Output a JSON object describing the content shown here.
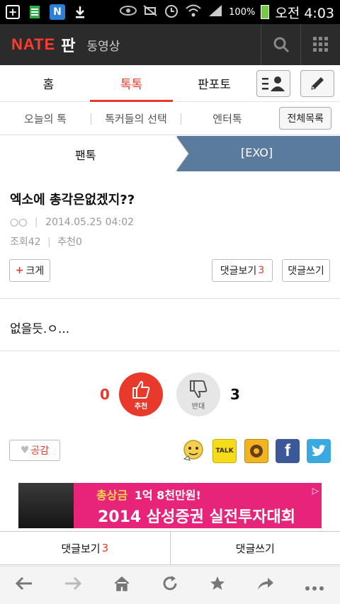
{
  "statusbar": {
    "icons": [
      "plus-box-icon",
      "sim-card-icon",
      "n-app-icon",
      "download-icon",
      "eye-icon",
      "mute-icon",
      "alarm-icon",
      "wifi-icon",
      "signal-icon"
    ],
    "n_label": "N",
    "battery": "100%",
    "battery_level": 1.0,
    "time": "오전 4:03"
  },
  "appbar": {
    "logo": "NATE",
    "brand": "판",
    "sub": "동영상",
    "icons": [
      "search-icon",
      "grid-menu-icon"
    ]
  },
  "main_tabs": [
    {
      "label": "홈",
      "active": false
    },
    {
      "label": "톡톡",
      "active": true
    },
    {
      "label": "판포토",
      "active": false
    }
  ],
  "sub_tabs": {
    "items": [
      "오늘의 톡",
      "톡커들의 선택",
      "엔터톡"
    ],
    "full_list": "전체목록"
  },
  "breadcrumb": {
    "left": "팬톡",
    "right": "[EXO]"
  },
  "article": {
    "title": "엑소에 총각은없겠지??",
    "author": "○○",
    "date": "2014.05.25 04:02",
    "views_label": "조회",
    "views": "42",
    "recommend_label": "추천",
    "recommend": "0",
    "enlarge_label": "크게",
    "view_comments_label": "댓글보기",
    "comment_count": "3",
    "write_comment_label": "댓글쓰기",
    "body": "없을듯.ㅇ..."
  },
  "votes": {
    "up_count": "0",
    "up_label": "추천",
    "down_label": "반대",
    "down_count": "3"
  },
  "share": {
    "like_label": "공감",
    "kakao_label": "TALK",
    "facebook_label": "f"
  },
  "banner": {
    "line1_prefix": "총상금",
    "line1_amount": "1억 8천만원!",
    "line2": "2014 삼성증권 실전투자대회"
  },
  "bottom_bar": {
    "view_comments": "댓글보기",
    "comment_count": "3",
    "write_comment": "댓글쓰기"
  },
  "toolbar": {
    "icons": [
      "back-icon",
      "forward-icon",
      "home-icon",
      "refresh-icon",
      "bookmark-star-icon",
      "share-icon",
      "more-icon"
    ]
  },
  "colors": {
    "accent": "#e8392b",
    "header": "#2b2b2b",
    "breadcrumb_active": "#5a7b9b",
    "banner": "#e7237a"
  }
}
